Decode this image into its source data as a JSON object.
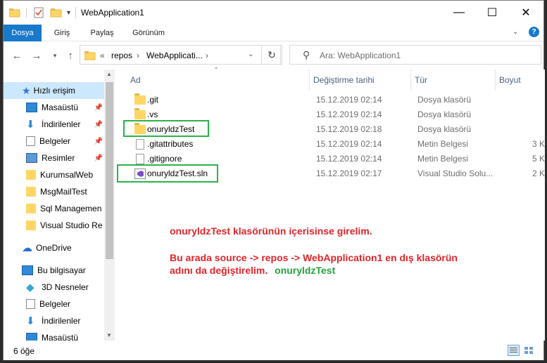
{
  "window": {
    "title": "WebApplication1",
    "minimize_glyph": "—",
    "maximize_glyph": "☐",
    "close_glyph": "✕"
  },
  "ribbon": {
    "tabs": [
      "Dosya",
      "Giriş",
      "Paylaş",
      "Görünüm"
    ],
    "active_tab": "Dosya",
    "accent": "#1979ca"
  },
  "address": {
    "overflow": "«",
    "segments": [
      "repos",
      "WebApplicati..."
    ],
    "separator": "›"
  },
  "search": {
    "placeholder": "Ara: WebApplication1"
  },
  "sidebar": {
    "items": [
      {
        "label": "Hızlı erişim",
        "icon": "star-icon",
        "selected": true
      },
      {
        "label": "Masaüstü",
        "icon": "desktop-icon",
        "pinned": true
      },
      {
        "label": "İndirilenler",
        "icon": "download-icon",
        "pinned": true
      },
      {
        "label": "Belgeler",
        "icon": "documents-icon",
        "pinned": true
      },
      {
        "label": "Resimler",
        "icon": "pictures-icon",
        "pinned": true
      },
      {
        "label": "KurumsalWeb",
        "icon": "folder-icon"
      },
      {
        "label": "MsgMailTest",
        "icon": "folder-icon"
      },
      {
        "label": "Sql Managemen",
        "icon": "folder-icon"
      },
      {
        "label": "Visual Studio Re",
        "icon": "folder-icon"
      },
      {
        "label": "OneDrive",
        "icon": "cloud-icon"
      },
      {
        "label": "Bu bilgisayar",
        "icon": "computer-icon"
      },
      {
        "label": "3D Nesneler",
        "icon": "3d-objects-icon"
      },
      {
        "label": "Belgeler",
        "icon": "documents-icon"
      },
      {
        "label": "İndirilenler",
        "icon": "download-icon"
      },
      {
        "label": "Masaüstü",
        "icon": "desktop-icon"
      }
    ]
  },
  "columns": {
    "name": "Ad",
    "date": "Değiştirme tarihi",
    "type": "Tür",
    "size": "Boyut"
  },
  "files": [
    {
      "name": ".git",
      "date": "15.12.2019 02:14",
      "type": "Dosya klasörü",
      "size": "",
      "icon": "folder-icon"
    },
    {
      "name": ".vs",
      "date": "15.12.2019 02:14",
      "type": "Dosya klasörü",
      "size": "",
      "icon": "folder-icon"
    },
    {
      "name": "onuryldzTest",
      "date": "15.12.2019 02:18",
      "type": "Dosya klasörü",
      "size": "",
      "icon": "folder-icon"
    },
    {
      "name": ".gitattributes",
      "date": "15.12.2019 02:14",
      "type": "Metin Belgesi",
      "size": "3 K",
      "icon": "text-file-icon"
    },
    {
      "name": ".gitignore",
      "date": "15.12.2019 02:14",
      "type": "Metin Belgesi",
      "size": "5 K",
      "icon": "text-file-icon"
    },
    {
      "name": "onuryldzTest.sln",
      "date": "15.12.2019 02:17",
      "type": "Visual Studio Solu...",
      "size": "2 K",
      "icon": "visual-studio-solution-icon"
    }
  ],
  "annotation": {
    "line1": "onuryldzTest klasörünün içerisinse girelim.",
    "line2": "Bu arada source -> repos -> WebApplication1 en dış klasörün",
    "line3": "adını da değiştirelim.",
    "line3_green": "onuryldzTest",
    "red": "#e0242a",
    "green": "#22a33d"
  },
  "status": {
    "count": "6 öğe"
  }
}
